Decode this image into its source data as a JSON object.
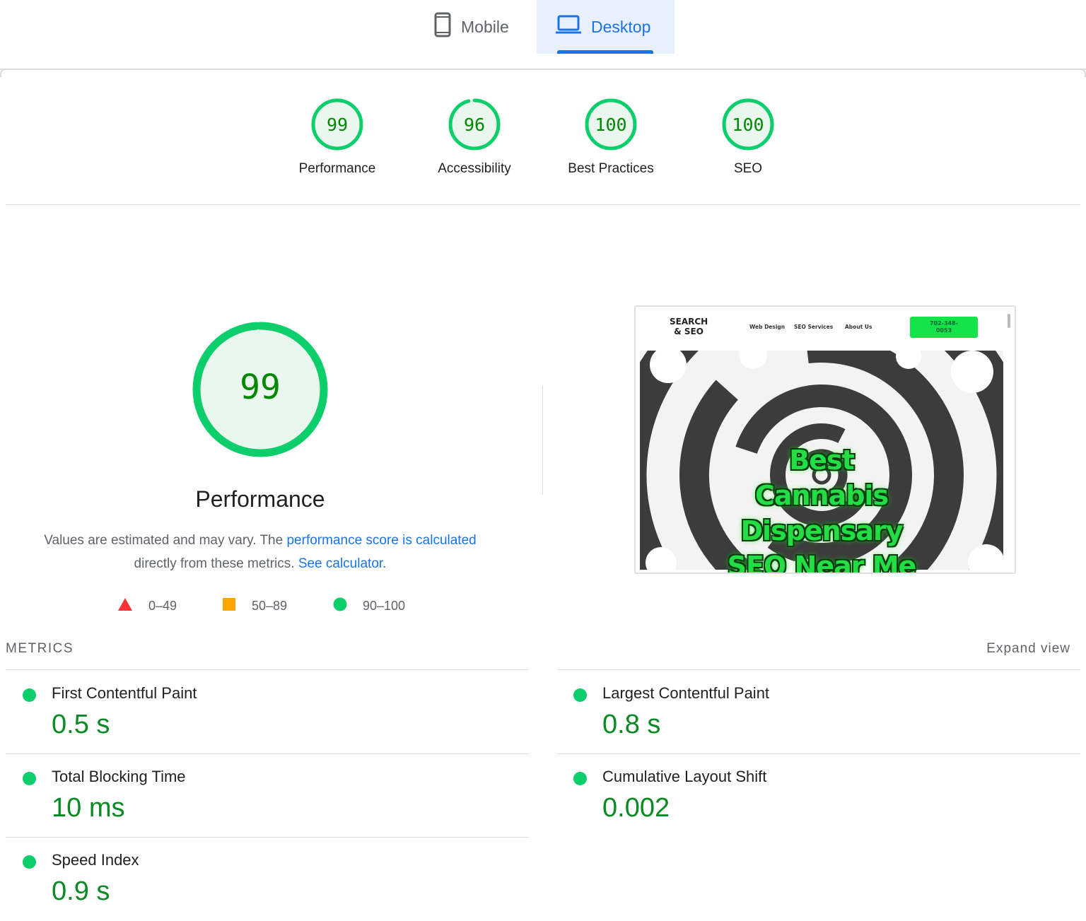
{
  "tabs": {
    "mobile_label": "Mobile",
    "desktop_label": "Desktop",
    "active": "Desktop",
    "mobile_icon": "phone-icon",
    "desktop_icon": "laptop-icon"
  },
  "scores": [
    {
      "value": "99",
      "label": "Performance",
      "fraction": 0.99
    },
    {
      "value": "96",
      "label": "Accessibility",
      "fraction": 0.96
    },
    {
      "value": "100",
      "label": "Best Practices",
      "fraction": 1.0
    },
    {
      "value": "100",
      "label": "SEO",
      "fraction": 1.0
    }
  ],
  "performance": {
    "score": "99",
    "fraction": 0.99,
    "title": "Performance",
    "desc_prefix": "Values are estimated and may vary. The ",
    "desc_link": "performance score is calculated",
    "desc_middle": "directly from these metrics. ",
    "desc_link2": "See calculator."
  },
  "legend": [
    {
      "shape": "triangle",
      "color": "#ff3333",
      "range": "0–49"
    },
    {
      "shape": "square",
      "color": "#ffa400",
      "range": "50–89"
    },
    {
      "shape": "circle",
      "color": "#0cce6b",
      "range": "90–100"
    }
  ],
  "thumbnail": {
    "logo_line1": "SEARCH",
    "logo_line2": "& SEO",
    "nav": [
      "Web Design",
      "SEO Services",
      "About Us"
    ],
    "phone_line1": "702-348-",
    "phone_line2": "0053",
    "hero_lines": [
      "Best",
      "Cannabis",
      "Dispensary",
      "SEO Near Me"
    ]
  },
  "metrics": {
    "heading": "METRICS",
    "expand_label": "Expand view",
    "items": [
      {
        "label": "First Contentful Paint",
        "value": "0.5 s"
      },
      {
        "label": "Largest Contentful Paint",
        "value": "0.8 s"
      },
      {
        "label": "Total Blocking Time",
        "value": "10 ms"
      },
      {
        "label": "Cumulative Layout Shift",
        "value": "0.002"
      },
      {
        "label": "Speed Index",
        "value": "0.9 s"
      }
    ]
  },
  "colors": {
    "pass": "#0cce6b",
    "pass_text": "#008800",
    "gauge_fill": "#eaf7ee",
    "link": "#1a73e8",
    "tab_active_bg": "#e8f0fe"
  }
}
